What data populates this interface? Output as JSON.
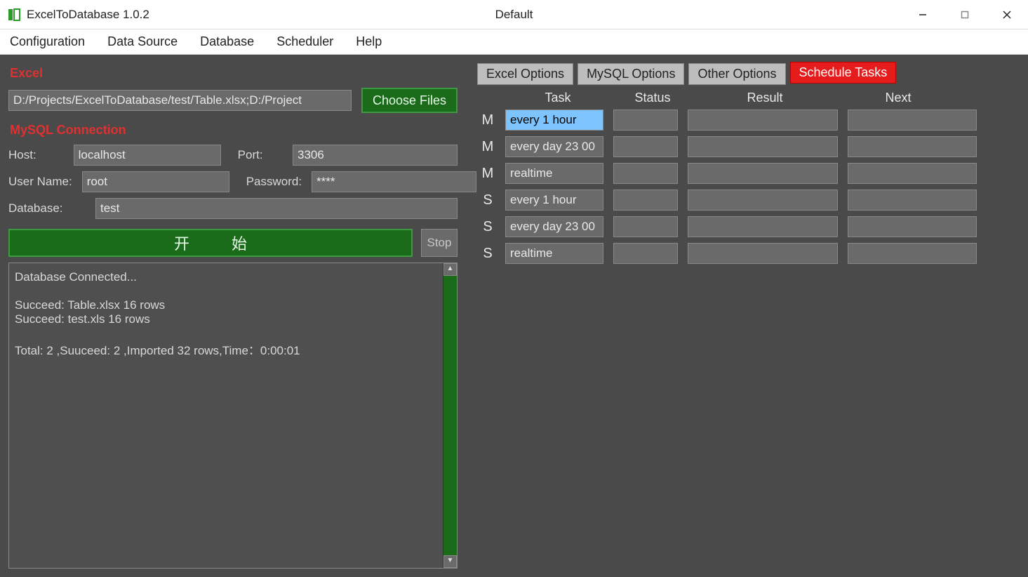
{
  "titlebar": {
    "app_title": "ExcelToDatabase 1.0.2",
    "center_title": "Default"
  },
  "menus": [
    "Configuration",
    "Data Source",
    "Database",
    "Scheduler",
    "Help"
  ],
  "left": {
    "excel_label": "Excel",
    "file_value": "D:/Projects/ExcelToDatabase/test/Table.xlsx;D:/Project",
    "choose_label": "Choose Files",
    "conn_label": "MySQL Connection",
    "host_label": "Host:",
    "host_value": "localhost",
    "port_label": "Port:",
    "port_value": "3306",
    "user_label": "User Name:",
    "user_value": "root",
    "pass_label": "Password:",
    "pass_value": "****",
    "db_label": "Database:",
    "db_value": "test",
    "start_label": "开始",
    "stop_label": "Stop",
    "log_text": "Database Connected...\n\nSucceed: Table.xlsx 16 rows\nSucceed: test.xls 16 rows\n\nTotal: 2 ,Suuceed: 2 ,Imported 32 rows,Time：0:00:01"
  },
  "tabs": {
    "items": [
      "Excel Options",
      "MySQL Options",
      "Other Options",
      "Schedule Tasks"
    ],
    "active_index": 3
  },
  "schedule": {
    "headers": {
      "task": "Task",
      "status": "Status",
      "result": "Result",
      "next": "Next"
    },
    "rows": [
      {
        "flag": "M",
        "task": "every 1 hour",
        "status": "",
        "result": "",
        "next": "",
        "selected": true
      },
      {
        "flag": "M",
        "task": "every day 23 00",
        "status": "",
        "result": "",
        "next": "",
        "selected": false
      },
      {
        "flag": "M",
        "task": "realtime",
        "status": "",
        "result": "",
        "next": "",
        "selected": false
      },
      {
        "flag": "S",
        "task": "every 1 hour",
        "status": "",
        "result": "",
        "next": "",
        "selected": false
      },
      {
        "flag": "S",
        "task": "every day 23 00",
        "status": "",
        "result": "",
        "next": "",
        "selected": false
      },
      {
        "flag": "S",
        "task": "realtime",
        "status": "",
        "result": "",
        "next": "",
        "selected": false
      }
    ]
  }
}
